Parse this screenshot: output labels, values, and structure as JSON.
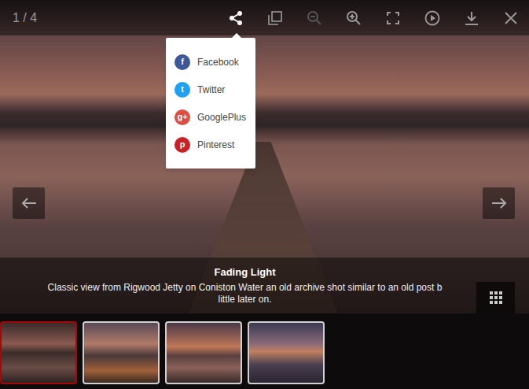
{
  "toolbar": {
    "counter": "1 / 4",
    "share_expanded": true,
    "zoom_out_disabled": true
  },
  "share_menu": {
    "items": [
      {
        "label": "Facebook",
        "glyph": "f",
        "color": "#3b5998"
      },
      {
        "label": "Twitter",
        "glyph": "t",
        "color": "#1da1f2"
      },
      {
        "label": "GooglePlus",
        "glyph": "g+",
        "color": "#dc4e41"
      },
      {
        "label": "Pinterest",
        "glyph": "p",
        "color": "#cb2027"
      }
    ]
  },
  "caption": {
    "title": "Fading Light",
    "lines": [
      "Classic view from Rigwood Jetty on Coniston Water an old archive shot similar to an old post b",
      "little later on."
    ]
  },
  "thumbnails": [
    {
      "selected": true
    },
    {
      "selected": false
    },
    {
      "selected": false
    },
    {
      "selected": false
    }
  ]
}
